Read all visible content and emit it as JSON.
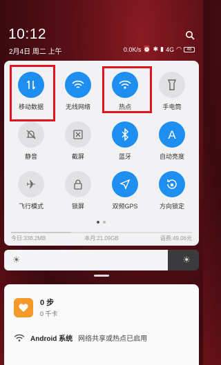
{
  "status": {
    "clock": "10:12",
    "date": "2月4日 周二 上午",
    "net_speed": "0.0K/s",
    "signal": "4G",
    "battery": "48"
  },
  "tiles": [
    {
      "label": "移动数据",
      "icon": "mobile-data-icon",
      "on": true
    },
    {
      "label": "无线网络",
      "icon": "wifi-icon",
      "on": true
    },
    {
      "label": "热点",
      "icon": "hotspot-icon",
      "on": true
    },
    {
      "label": "手电筒",
      "icon": "flashlight-icon",
      "on": false
    },
    {
      "label": "静音",
      "icon": "mute-icon",
      "on": false
    },
    {
      "label": "截屏",
      "icon": "screenshot-icon",
      "on": false
    },
    {
      "label": "蓝牙",
      "icon": "bluetooth-icon",
      "on": true
    },
    {
      "label": "自动亮度",
      "icon": "auto-brightness-icon",
      "on": true
    },
    {
      "label": "飞行模式",
      "icon": "airplane-icon",
      "on": false
    },
    {
      "label": "锁屏",
      "icon": "lock-icon",
      "on": false
    },
    {
      "label": "双频GPS",
      "icon": "gps-icon",
      "on": true
    },
    {
      "label": "方向锁定",
      "icon": "rotation-lock-icon",
      "on": true
    }
  ],
  "storage": {
    "today": "今日:338.2MB",
    "month": "本月:21.09GB",
    "remaining": "语费:49.06元"
  },
  "brightness": {
    "level": 0.84
  },
  "notifications": {
    "health": {
      "steps": "0 步",
      "calories": "0 千卡"
    },
    "system": {
      "app": "Android 系统",
      "message": "网络共享或热点已启用"
    }
  },
  "colors": {
    "accent": "#1e8ff0",
    "highlight": "#e0141e",
    "health": "#f39a2a"
  }
}
